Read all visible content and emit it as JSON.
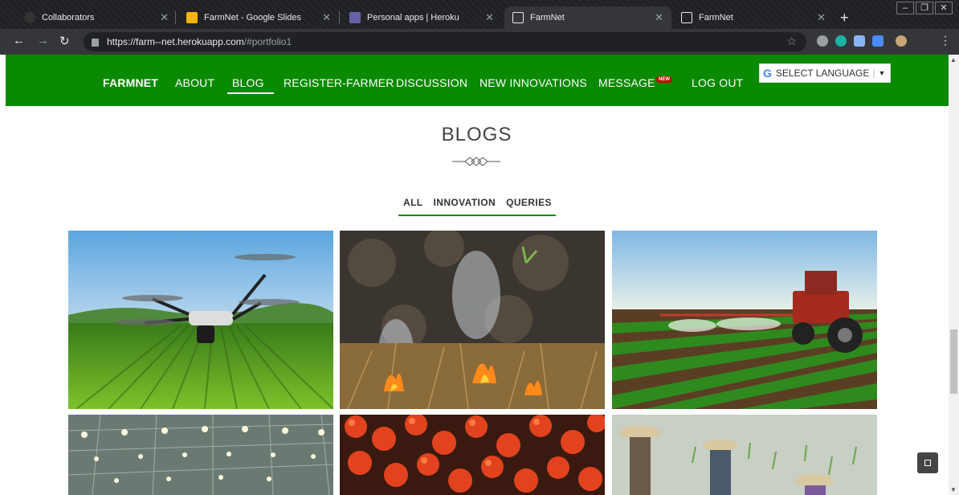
{
  "browser": {
    "tabs": [
      {
        "title": "Collaborators",
        "active": false
      },
      {
        "title": "FarmNet - Google Slides",
        "active": false
      },
      {
        "title": "Personal apps | Heroku",
        "active": false
      },
      {
        "title": "FarmNet",
        "active": true
      },
      {
        "title": "FarmNet",
        "active": false
      }
    ],
    "url_host": "https://farm--net.herokuapp.com",
    "url_path": "/#portfolio1"
  },
  "nav": {
    "brand": "FARMNET",
    "links": [
      "ABOUT",
      "BLOG",
      "REGISTER-FARMER",
      "DISCUSSION",
      "NEW INNOVATIONS",
      "MESSAGE",
      "LOG OUT"
    ],
    "active_link": "BLOG",
    "message_badge": "NEW",
    "language_label": "SELECT LANGUAGE",
    "language_g": "G"
  },
  "blogs": {
    "title": "BLOGS",
    "filters": [
      "ALL",
      "INNOVATION",
      "QUERIES"
    ],
    "active_filter": "ALL",
    "cards": [
      {
        "subject": "drone over crop field"
      },
      {
        "subject": "burning stubble fire"
      },
      {
        "subject": "tractor spraying field"
      },
      {
        "subject": "greenhouse lights"
      },
      {
        "subject": "tomatoes"
      },
      {
        "subject": "farmers in rice paddy"
      }
    ]
  },
  "colors": {
    "nav_green": "#0a8a00",
    "badge_red": "#cc0000"
  }
}
